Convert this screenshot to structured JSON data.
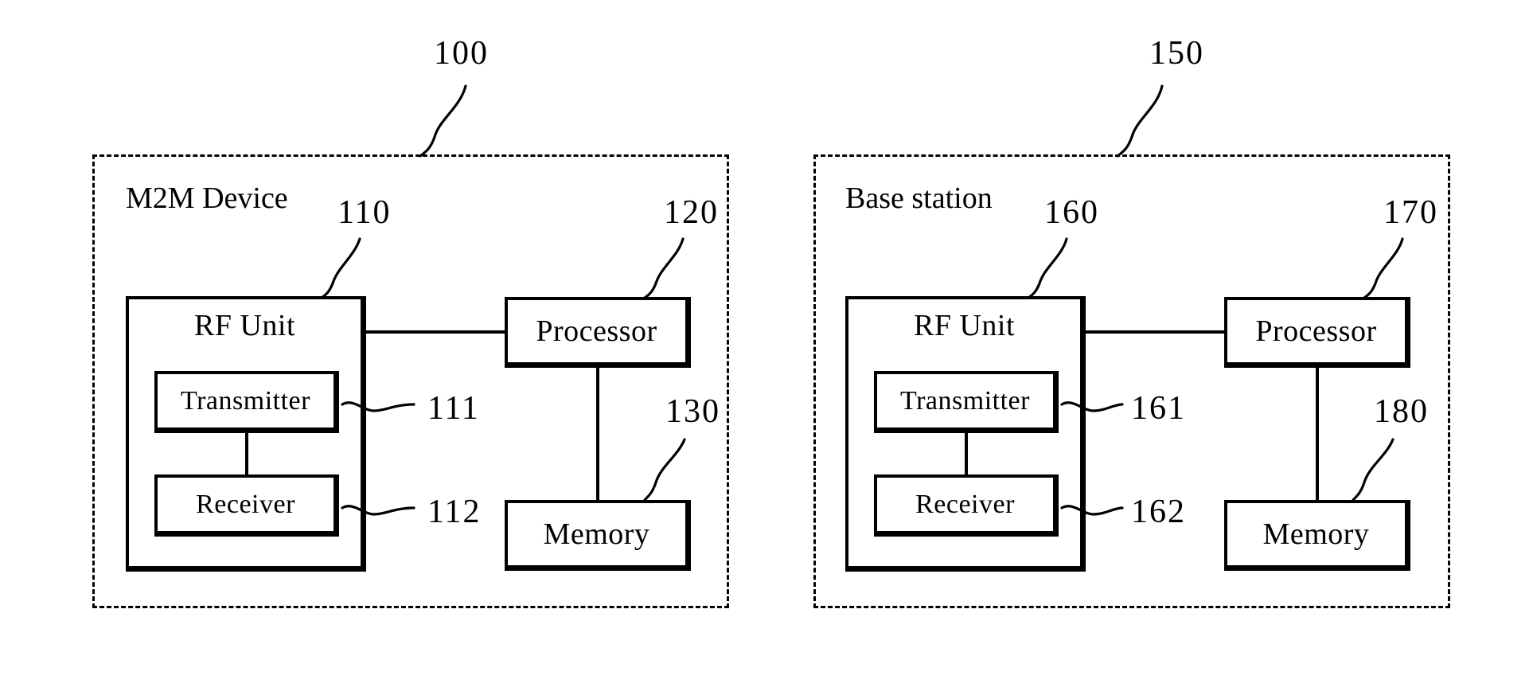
{
  "figure": {
    "type": "patent-block-diagram",
    "background_color": "#ffffff",
    "line_color": "#000000"
  },
  "panels": [
    {
      "id": "m2m-device",
      "container_label": "M2M Device",
      "container_ref": "100",
      "blocks": [
        {
          "id": "rf-unit",
          "label": "RF Unit",
          "ref": "110"
        },
        {
          "id": "transmitter",
          "label": "Transmitter",
          "ref": "111"
        },
        {
          "id": "receiver",
          "label": "Receiver",
          "ref": "112"
        },
        {
          "id": "processor",
          "label": "Processor",
          "ref": "120"
        },
        {
          "id": "memory",
          "label": "Memory",
          "ref": "130"
        }
      ]
    },
    {
      "id": "base-station",
      "container_label": "Base station",
      "container_ref": "150",
      "blocks": [
        {
          "id": "rf-unit",
          "label": "RF Unit",
          "ref": "160"
        },
        {
          "id": "transmitter",
          "label": "Transmitter",
          "ref": "161"
        },
        {
          "id": "receiver",
          "label": "Receiver",
          "ref": "162"
        },
        {
          "id": "processor",
          "label": "Processor",
          "ref": "170"
        },
        {
          "id": "memory",
          "label": "Memory",
          "ref": "180"
        }
      ]
    }
  ],
  "chart_data": {
    "type": "diagram",
    "title": "",
    "nodes": [
      {
        "id": "100",
        "label": "M2M Device",
        "kind": "system-boundary",
        "panel": "left"
      },
      {
        "id": "110",
        "label": "RF Unit",
        "kind": "block",
        "panel": "left",
        "parent": "100"
      },
      {
        "id": "111",
        "label": "Transmitter",
        "kind": "block",
        "panel": "left",
        "parent": "110"
      },
      {
        "id": "112",
        "label": "Receiver",
        "kind": "block",
        "panel": "left",
        "parent": "110"
      },
      {
        "id": "120",
        "label": "Processor",
        "kind": "block",
        "panel": "left",
        "parent": "100"
      },
      {
        "id": "130",
        "label": "Memory",
        "kind": "block",
        "panel": "left",
        "parent": "100"
      },
      {
        "id": "150",
        "label": "Base station",
        "kind": "system-boundary",
        "panel": "right"
      },
      {
        "id": "160",
        "label": "RF Unit",
        "kind": "block",
        "panel": "right",
        "parent": "150"
      },
      {
        "id": "161",
        "label": "Transmitter",
        "kind": "block",
        "panel": "right",
        "parent": "160"
      },
      {
        "id": "162",
        "label": "Receiver",
        "kind": "block",
        "panel": "right",
        "parent": "160"
      },
      {
        "id": "170",
        "label": "Processor",
        "kind": "block",
        "panel": "right",
        "parent": "150"
      },
      {
        "id": "180",
        "label": "Memory",
        "kind": "block",
        "panel": "right",
        "parent": "150"
      }
    ],
    "edges": [
      {
        "from": "110",
        "to": "120",
        "style": "solid"
      },
      {
        "from": "111",
        "to": "112",
        "style": "solid"
      },
      {
        "from": "120",
        "to": "130",
        "style": "solid"
      },
      {
        "from": "160",
        "to": "170",
        "style": "solid"
      },
      {
        "from": "161",
        "to": "162",
        "style": "solid"
      },
      {
        "from": "170",
        "to": "180",
        "style": "solid"
      }
    ]
  }
}
